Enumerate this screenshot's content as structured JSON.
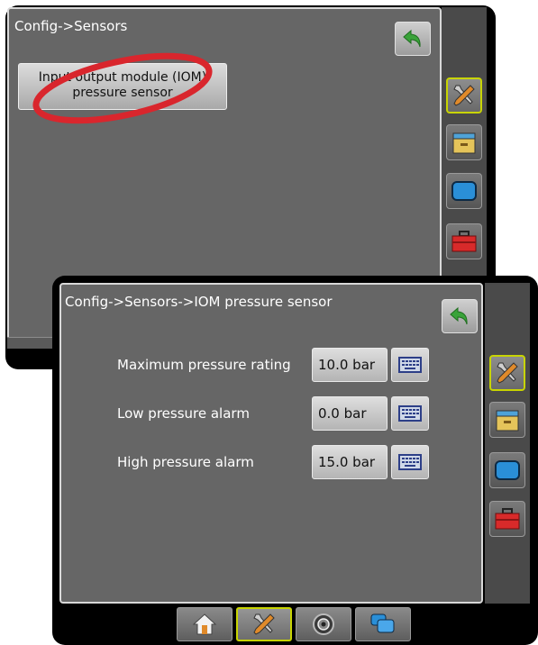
{
  "back_screen": {
    "title": "Config->Sensors",
    "iom_button_label": "Input output module (IOM) pressure sensor"
  },
  "front_screen": {
    "title": "Config->Sensors->IOM pressure sensor",
    "rows": [
      {
        "label": "Maximum pressure rating",
        "value": "10.0 bar"
      },
      {
        "label": "Low pressure alarm",
        "value": "0.0 bar"
      },
      {
        "label": "High pressure alarm",
        "value": "15.0 bar"
      }
    ]
  },
  "side_nav": [
    "tools-icon",
    "storage-box-icon",
    "display-icon",
    "toolbox-icon"
  ],
  "bottom_tabs": [
    "home-icon",
    "tools-icon",
    "camera-icon",
    "screens-icon"
  ],
  "colors": {
    "panel": "#666666",
    "active_border": "#c8d400",
    "annotation_circle": "#d9262d",
    "back_arrow": "#3aa33a"
  }
}
